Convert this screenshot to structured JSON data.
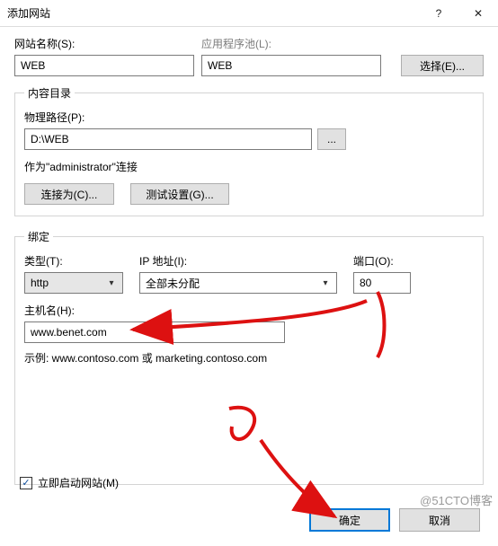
{
  "window": {
    "title": "添加网站",
    "help_glyph": "?",
    "close_glyph": "✕"
  },
  "site": {
    "name_label": "网站名称(S):",
    "name_value": "WEB",
    "apppool_label": "应用程序池(L):",
    "apppool_value": "WEB",
    "select_btn": "选择(E)..."
  },
  "content_dir": {
    "legend": "内容目录",
    "path_label": "物理路径(P):",
    "path_value": "D:\\WEB",
    "browse_btn": "...",
    "connect_as_text": "作为\"administrator\"连接",
    "connect_as_btn": "连接为(C)...",
    "test_btn": "测试设置(G)..."
  },
  "binding": {
    "legend": "绑定",
    "type_label": "类型(T):",
    "type_value": "http",
    "ip_label": "IP 地址(I):",
    "ip_value": "全部未分配",
    "port_label": "端口(O):",
    "port_value": "80",
    "hostname_label": "主机名(H):",
    "hostname_value": "www.benet.com",
    "example": "示例: www.contoso.com 或 marketing.contoso.com"
  },
  "start_now": {
    "checked_glyph": "✓",
    "label": "立即启动网站(M)"
  },
  "footer": {
    "ok": "确定",
    "cancel": "取消"
  },
  "watermark": "@51CTO博客"
}
